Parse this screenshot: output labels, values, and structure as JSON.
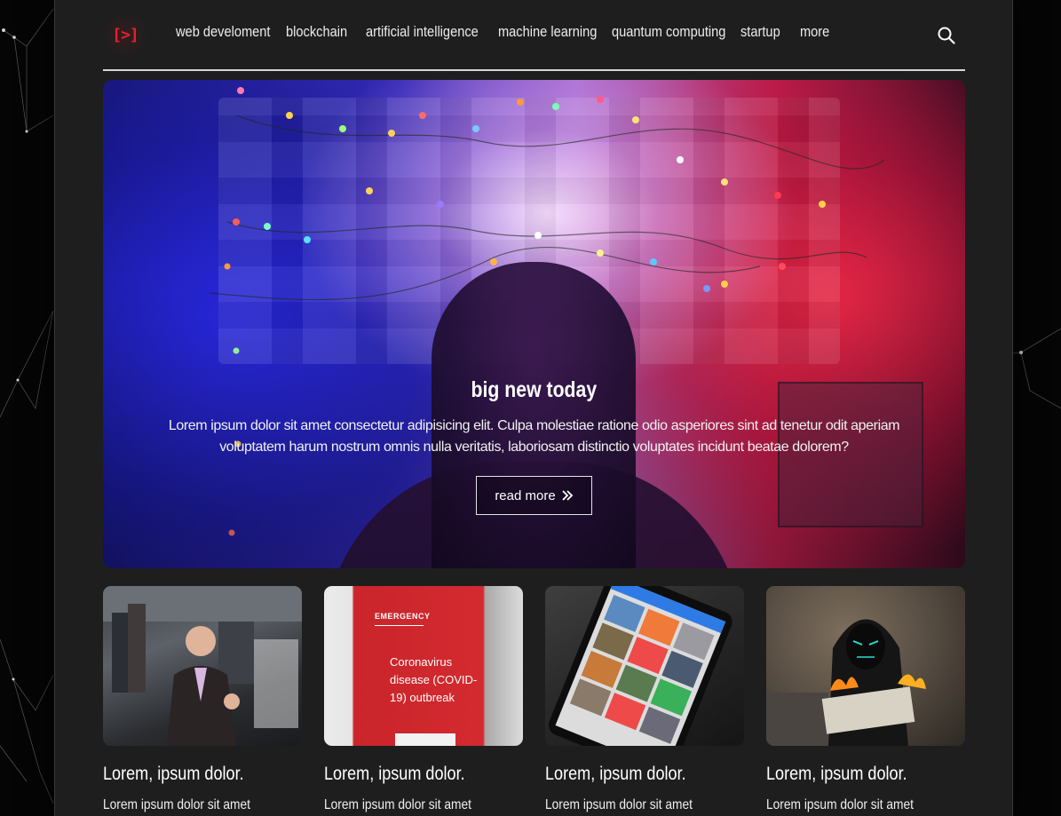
{
  "logo": {
    "text": "[>]"
  },
  "nav": {
    "items": [
      "web develoment",
      "blockchain",
      "artificial intelligence",
      "machine learning",
      "quantum computing",
      "startup",
      "more"
    ]
  },
  "hero": {
    "title": "big new today",
    "text": "Lorem ipsum dolor sit amet consectetur adipisicing elit. Culpa molestiae ratione odio asperiores sint ad tenetur odit aperiam voluptatem harum nostrum omnis nulla veritatis, laboriosam distinctio voluptates incidunt beatae dolorem?",
    "button_label": "read more"
  },
  "cards": [
    {
      "title": "Lorem, ipsum dolor.",
      "text": "Lorem ipsum dolor sit amet"
    },
    {
      "title": "Lorem, ipsum dolor.",
      "text": "Lorem ipsum dolor sit amet"
    },
    {
      "title": "Lorem, ipsum dolor.",
      "text": "Lorem ipsum dolor sit amet"
    },
    {
      "title": "Lorem, ipsum dolor.",
      "text": "Lorem ipsum dolor sit amet"
    }
  ],
  "card_images": {
    "card2_heading": "EMERGENCY",
    "card2_lines": [
      "Coronavirus",
      "disease (COVID-",
      "19) outbreak"
    ]
  },
  "colors": {
    "accent": "#e8202d",
    "page_bg": "#1e1e1f",
    "outer_bg": "#050505"
  }
}
